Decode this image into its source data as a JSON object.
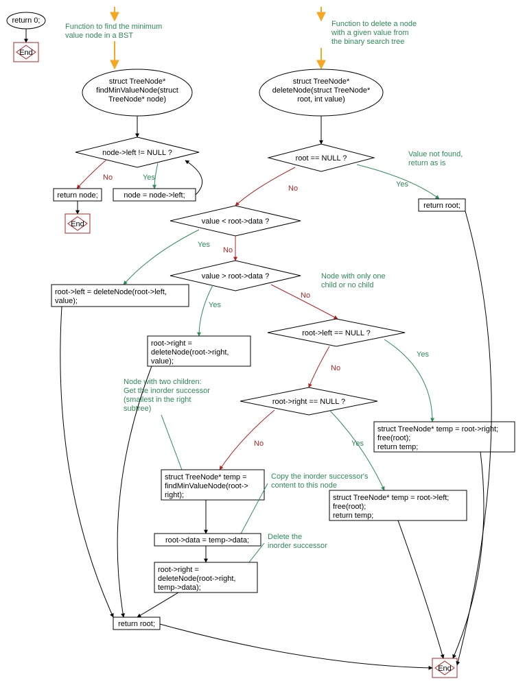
{
  "func1": {
    "start_box": "return 0;",
    "end": "End"
  },
  "findMin": {
    "comment": [
      "Function to find the minimum",
      "value node in a BST"
    ],
    "signature": [
      "struct TreeNode*",
      "findMinValueNode(struct",
      "TreeNode* node)"
    ],
    "cond": "node->left != NULL ?",
    "ret": "return node;",
    "assign": "node = node->left;",
    "end": "End",
    "yes": "Yes",
    "no": "No"
  },
  "delete": {
    "comment": [
      "Function to delete a node",
      "with a given value from",
      "the binary search tree"
    ],
    "signature": [
      "struct TreeNode*",
      "deleteNode(struct TreeNode*",
      "root, int value)"
    ],
    "cond_null": "root == NULL ?",
    "notfound_comment": [
      "Value not found,",
      "return as is"
    ],
    "ret_root_nf": "return root;",
    "cond_lt": "value < root->data ?",
    "left_recurse": [
      "root->left = deleteNode(root->left,",
      "value);"
    ],
    "cond_gt": "value > root->data ?",
    "right_recurse": [
      "root->right =",
      "deleteNode(root->right,",
      "value);"
    ],
    "onechild_comment": [
      "Node with only one",
      "child or no child"
    ],
    "cond_left_null": "root->left == NULL ?",
    "temp_right": [
      "struct TreeNode* temp = root->right;",
      "free(root);",
      "return temp;"
    ],
    "cond_right_null": "root->right == NULL ?",
    "temp_left": [
      "struct TreeNode* temp = root->left;",
      "free(root);",
      "return temp;"
    ],
    "twochild_comment": [
      "Node with two children:",
      "Get the inorder successor",
      "(smallest in the right",
      "subtree)"
    ],
    "find_succ": [
      "struct TreeNode* temp =",
      "findMinValueNode(root->",
      "right);"
    ],
    "copy_comment": [
      "Copy the inorder successor's",
      "content to this node"
    ],
    "copy_data": "root->data = temp->data;",
    "del_succ_comment": [
      "Delete the",
      "inorder successor"
    ],
    "del_succ": [
      "root->right =",
      "deleteNode(root->right,",
      "temp->data);"
    ],
    "ret_root": "return root;",
    "end": "End",
    "yes": "Yes",
    "no": "No"
  }
}
